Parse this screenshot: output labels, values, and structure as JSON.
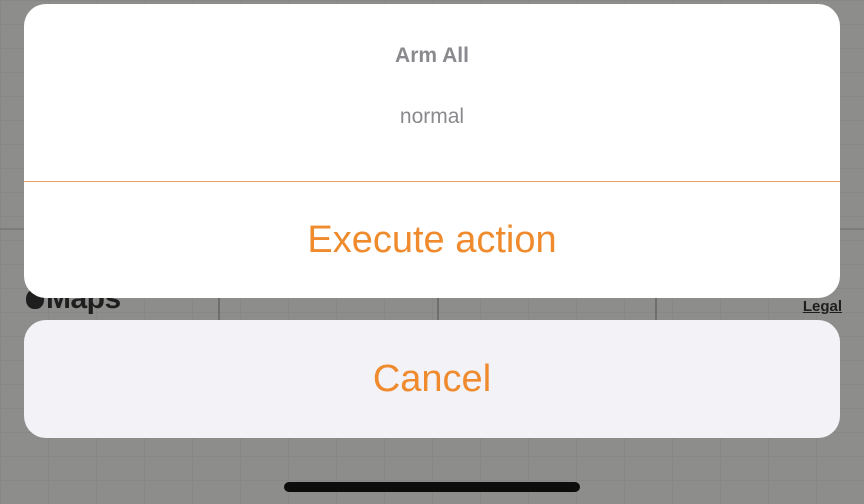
{
  "map": {
    "logo_text": "Maps",
    "legal_label": "Legal"
  },
  "action_sheet": {
    "title": "Arm All",
    "message": "normal",
    "execute_label": "Execute action",
    "cancel_label": "Cancel",
    "accent_color": "#ef8a2d",
    "divider_color": "#f2a06a"
  },
  "icons": {
    "map_logo": "apple-logo-icon"
  }
}
